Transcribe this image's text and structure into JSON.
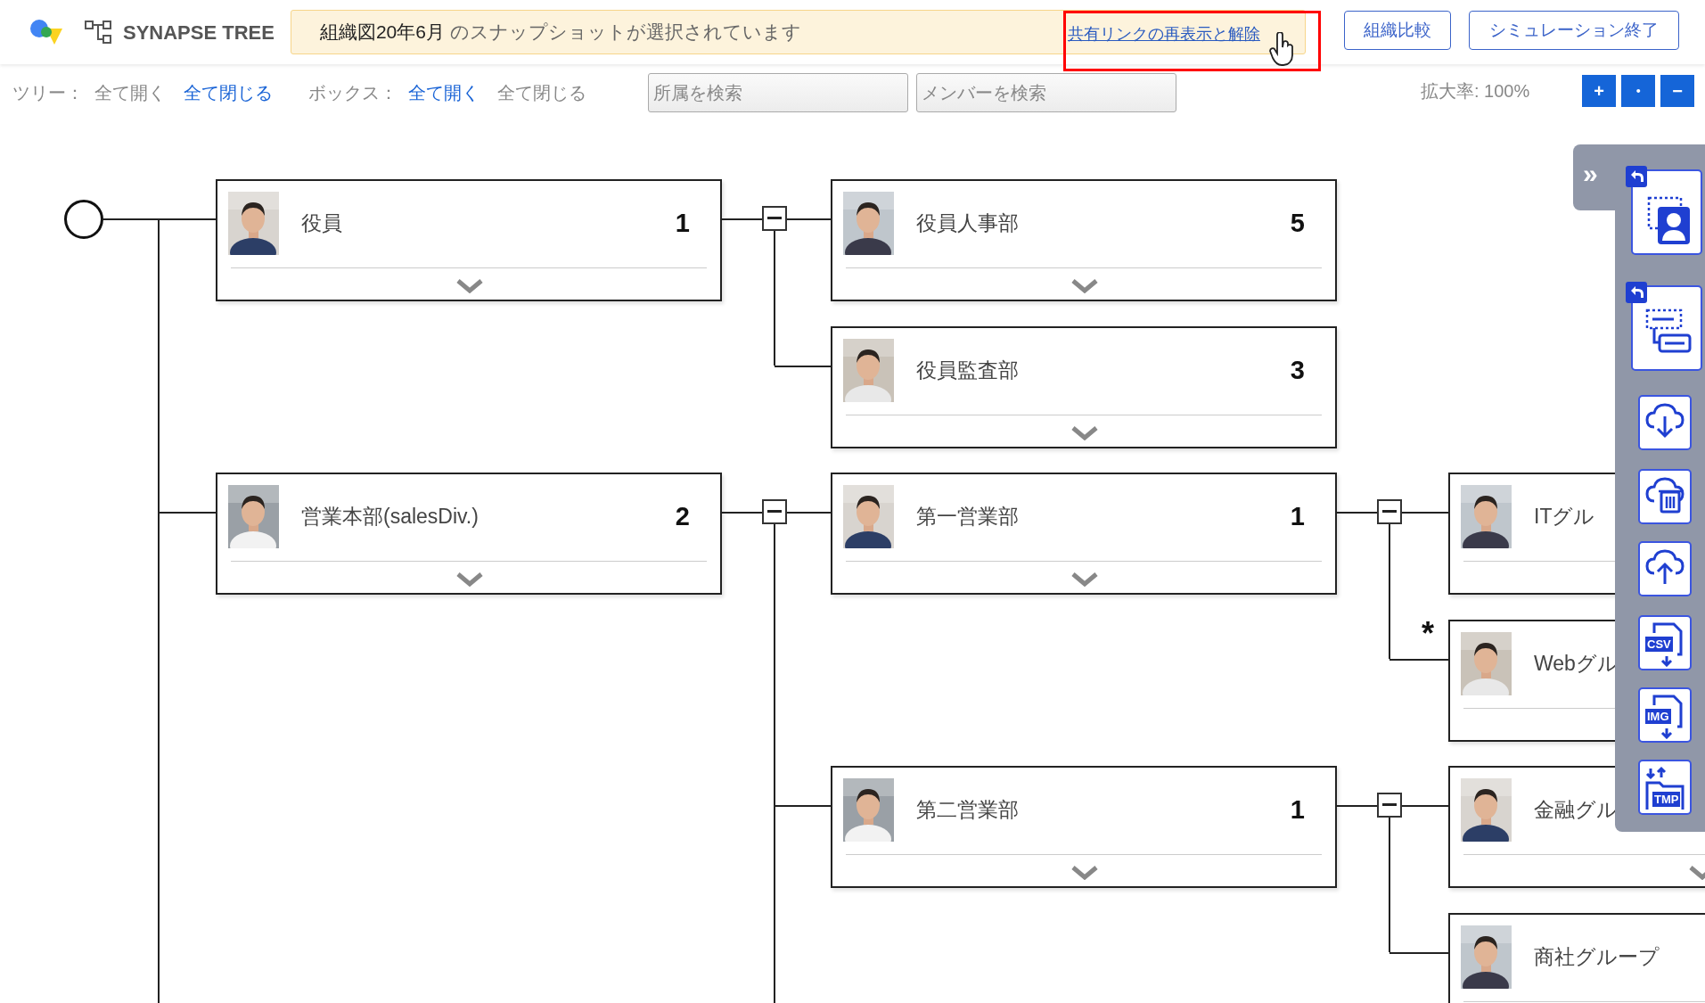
{
  "header": {
    "logo_text": "SYNAPSE TREE",
    "banner": {
      "snapshot_name": "組織図20年6月",
      "message": "のスナップショットが選択されています",
      "link": "共有リンクの再表示と解除",
      "highlighted": true
    },
    "buttons": [
      "組織比較",
      "シミュレーション終了"
    ]
  },
  "toolbar": {
    "groups": [
      {
        "label": "ツリー：",
        "items": [
          {
            "label": "全て開く",
            "disabled": true
          },
          {
            "label": "全て閉じる",
            "disabled": false
          }
        ]
      },
      {
        "label": "ボックス：",
        "items": [
          {
            "label": "全て開く",
            "disabled": false
          },
          {
            "label": "全て閉じる",
            "disabled": true
          }
        ]
      }
    ],
    "search": [
      {
        "placeholder": "所属を検索"
      },
      {
        "placeholder": "メンバーを検索"
      }
    ],
    "zoom": {
      "label": "拡大率: 100%",
      "buttons": [
        "+",
        "・",
        "−"
      ]
    }
  },
  "tree": {
    "continues": true,
    "children": [
      {
        "name": "役員",
        "count": "1",
        "expanded": true,
        "children": [
          {
            "name": "役員人事部",
            "count": "5"
          },
          {
            "name": "役員監査部",
            "count": "3"
          }
        ]
      },
      {
        "name": "営業本部(salesDiv.)",
        "count": "2",
        "expanded": true,
        "continues": true,
        "children": [
          {
            "name": "第一営業部",
            "count": "1",
            "expanded": true,
            "children": [
              {
                "name": "ITグル"
              },
              {
                "name": "Webグル",
                "mark": "*"
              }
            ]
          },
          {
            "name": "第二営業部",
            "count": "1",
            "expanded": true,
            "children": [
              {
                "name": "金融グル"
              },
              {
                "name": "商社グループ"
              }
            ]
          }
        ]
      }
    ]
  },
  "side_panel": {
    "toggle": "»",
    "tools": [
      {
        "kind": "undo-photo"
      },
      {
        "kind": "undo-layout"
      },
      {
        "kind": "cloud-down"
      },
      {
        "kind": "cloud-trash"
      },
      {
        "kind": "cloud-up"
      },
      {
        "kind": "file-down",
        "badge": "CSV"
      },
      {
        "kind": "file-down",
        "badge": "IMG"
      },
      {
        "kind": "folder-swap",
        "badge": "TMP"
      }
    ]
  }
}
